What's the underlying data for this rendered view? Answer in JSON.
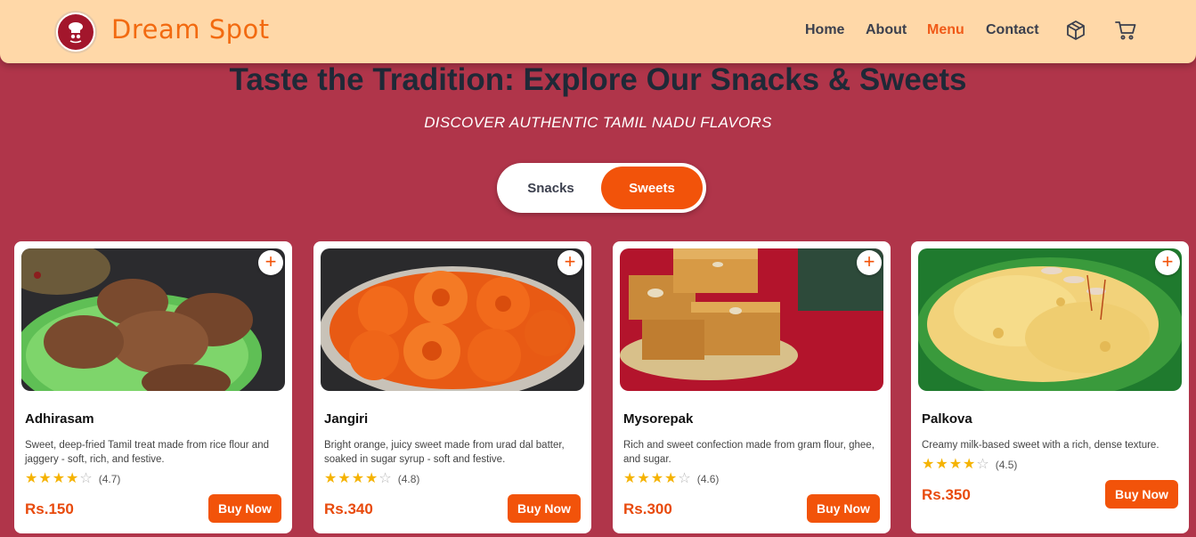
{
  "brand": {
    "name": "Dream Spot",
    "logo_icon": "chef-logo-icon"
  },
  "nav": {
    "items": [
      {
        "label": "Home",
        "active": false
      },
      {
        "label": "About",
        "active": false
      },
      {
        "label": "Menu",
        "active": true
      },
      {
        "label": "Contact",
        "active": false
      }
    ],
    "icons": [
      "package-icon",
      "cart-icon"
    ]
  },
  "hero": {
    "title": "Taste the Tradition: Explore Our Snacks & Sweets",
    "subtitle": "DISCOVER AUTHENTIC TAMIL NADU FLAVORS"
  },
  "toggle": {
    "options": [
      "Snacks",
      "Sweets"
    ],
    "selected": "Sweets"
  },
  "colors": {
    "background": "#b0354a",
    "header": "#ffd8a8",
    "accent": "#f2530a",
    "brand_text": "#f26a10",
    "star": "#f5b301"
  },
  "products": [
    {
      "name": "Adhirasam",
      "description": "Sweet, deep-fried Tamil treat made from rice flour and jaggery - soft, rich, and festive.",
      "rating": 4,
      "rating_text": "(4.7)",
      "price": "Rs.150",
      "button": "Buy Now",
      "add_label": "+"
    },
    {
      "name": "Jangiri",
      "description": "Bright orange, juicy sweet made from urad dal batter, soaked in sugar syrup - soft and festive.",
      "rating": 4,
      "rating_text": "(4.8)",
      "price": "Rs.340",
      "button": "Buy Now",
      "add_label": "+"
    },
    {
      "name": "Mysorepak",
      "description": "Rich and sweet confection made from gram flour, ghee, and sugar.",
      "rating": 4,
      "rating_text": "(4.6)",
      "price": "Rs.300",
      "button": "Buy Now",
      "add_label": "+"
    },
    {
      "name": "Palkova",
      "description": "Creamy milk-based sweet with a rich, dense texture.",
      "rating": 4,
      "rating_text": "(4.5)",
      "price": "Rs.350",
      "button": "Buy Now",
      "add_label": "+"
    }
  ]
}
